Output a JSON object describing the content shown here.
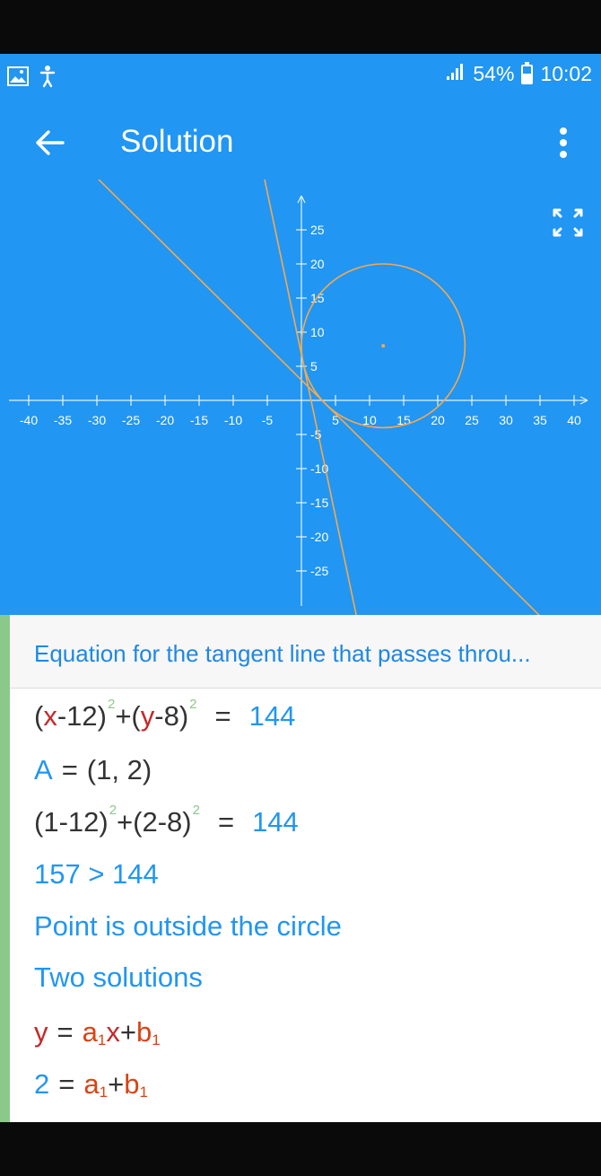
{
  "status": {
    "signal": ".ıll",
    "battery": "54%",
    "time": "10:02"
  },
  "app_bar": {
    "title": "Solution"
  },
  "graph": {
    "x_ticks": [
      "-40",
      "-35",
      "-30",
      "-25",
      "-20",
      "-15",
      "-10",
      "-5",
      "5",
      "10",
      "15",
      "20",
      "25",
      "30",
      "35",
      "40"
    ],
    "y_ticks": [
      "25",
      "20",
      "15",
      "10",
      "5",
      "-5",
      "-10",
      "-15",
      "-20",
      "-25"
    ],
    "circle": {
      "center": [
        12,
        8
      ],
      "radius": 12
    },
    "point": [
      1,
      2
    ],
    "accent_color": "#F9A84A"
  },
  "equation_header": "Equation for the tangent line that passes throu...",
  "steps": {
    "s1": {
      "a": "(",
      "x": "x",
      "b": "-12)",
      "sq1": "2",
      "plus": "+",
      "c": "(",
      "y": "y",
      "d": "-8)",
      "sq2": "2",
      "eq": "=",
      "rhs": "144"
    },
    "s2": {
      "lhs": "A",
      "eq": "=",
      "rhs": "(1,  2)"
    },
    "s3": {
      "a": "(1-12)",
      "sq1": "2",
      "plus": "+",
      "b": "(2-8)",
      "sq2": "2",
      "eq": "=",
      "rhs": "144"
    },
    "s4": "157 > 144",
    "s5": "Point is outside the circle",
    "s6": "Two solutions",
    "s7": {
      "y": "y",
      "eq": "=",
      "a": "a",
      "a_sub": "1",
      "x": "x",
      "plus": "+",
      "b": "b",
      "b_sub": "1"
    },
    "s8": {
      "lhs": "2",
      "eq": "=",
      "a": "a",
      "a_sub": "1",
      "plus": "+",
      "b": "b",
      "b_sub": "1"
    }
  }
}
